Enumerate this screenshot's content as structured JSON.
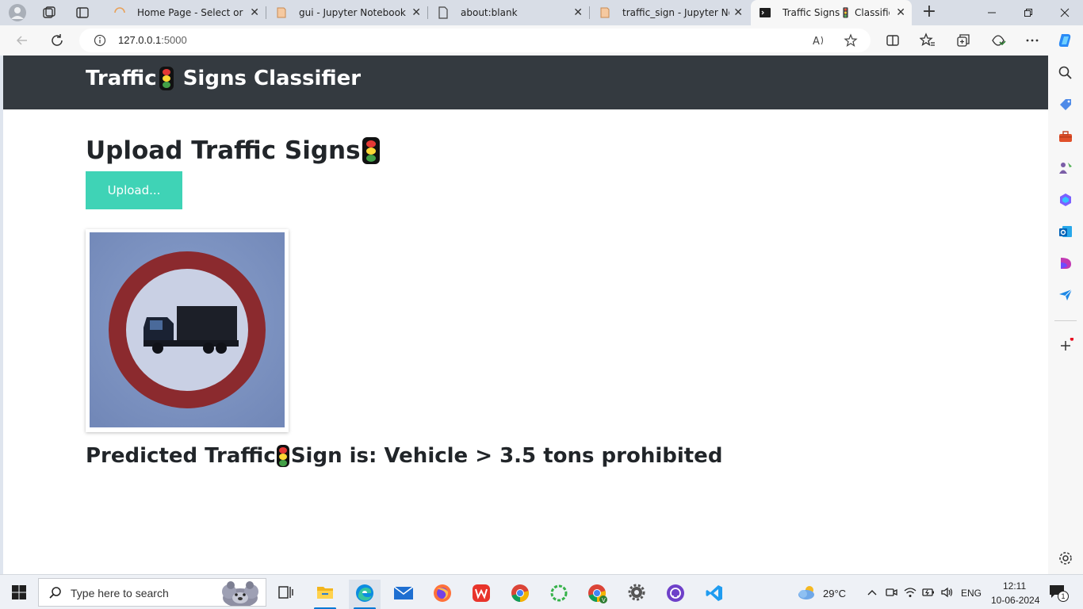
{
  "browser": {
    "tabs": [
      {
        "title": "Home Page - Select or create",
        "active": false
      },
      {
        "title": "gui - Jupyter Notebook",
        "active": false
      },
      {
        "title": "about:blank",
        "active": false
      },
      {
        "title": "traffic_sign - Jupyter Notebook",
        "active": false
      },
      {
        "title": "Traffic Signs🚦 Classification",
        "active": true
      }
    ],
    "url_host": "127.0.0.1",
    "url_port": ":5000"
  },
  "page": {
    "navbar_brand_prefix": "Traffic",
    "navbar_brand_suffix": " Signs Classifier",
    "heading": "Upload Traffic Signs",
    "upload_button": "Upload...",
    "prediction_prefix": "Predicted Traffic",
    "prediction_text": "Sign is: Vehicle > 3.5 tons prohibited"
  },
  "taskbar": {
    "search_placeholder": "Type here to search",
    "weather_temp": "29°C",
    "language": "ENG",
    "time": "12:11",
    "date": "10-06-2024",
    "notification_count": "1"
  },
  "colors": {
    "navbar_bg": "#343a40",
    "upload_button_bg": "#3fd3b6",
    "sign_ring": "#8b2a2e",
    "sign_bg": "#7d93c2"
  }
}
